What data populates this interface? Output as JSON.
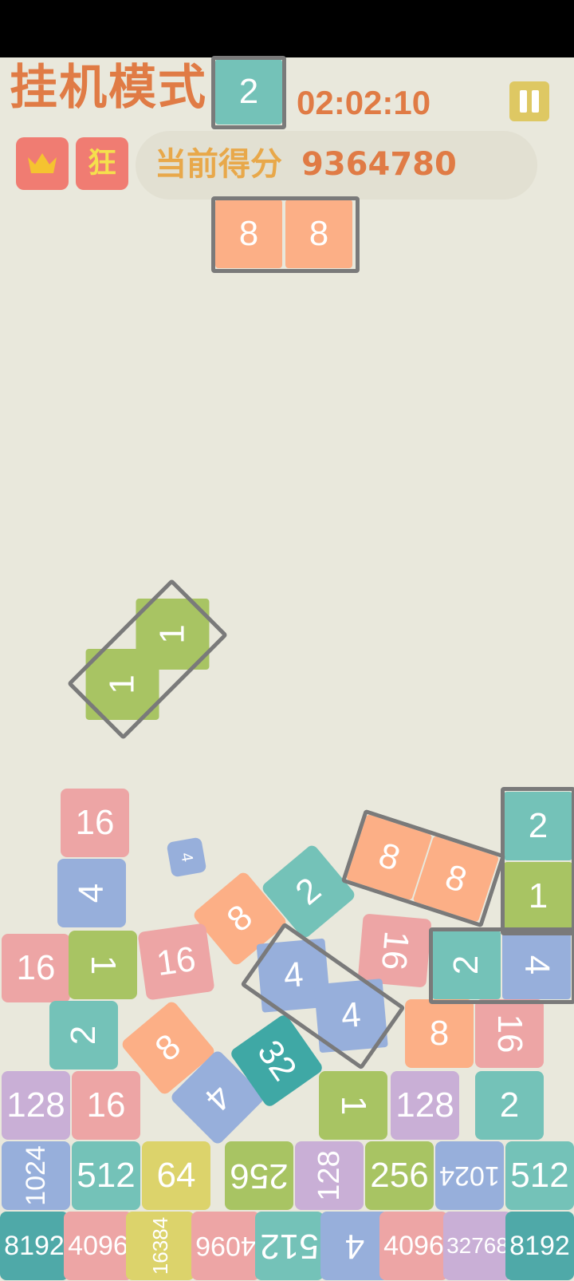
{
  "header": {
    "title": "挂机模式",
    "timer": "02:02:10",
    "score_label": "当前得分",
    "score_value": "9364780",
    "badge_kuang": "狂",
    "icons": [
      "crown-icon",
      "pause-icon"
    ]
  },
  "falling_piece": {
    "top": "2",
    "left": "8",
    "right": "8"
  },
  "tilted_piece": {
    "a": "1",
    "b": "1"
  },
  "tiles": {
    "r_16a": "16",
    "r_4a": "4",
    "r_4small": "4",
    "r_8a": "8",
    "r_2a": "2",
    "r_8pair1": "8",
    "r_8pair2": "8",
    "r_2v": "2",
    "r_1v": "1",
    "r_16b": "16",
    "r_1b": "1",
    "r_16c": "16",
    "r_16d": "16",
    "r_2b": "2",
    "r_4pair": "4",
    "r_44a": "4",
    "r_44b": "4",
    "r_2c": "2",
    "r_8b": "8",
    "r_8c": "8",
    "r_16e": "16",
    "r_4b": "4",
    "r_32": "32",
    "r_128a": "128",
    "r_16f": "16",
    "r_1c": "1",
    "r_128b": "128",
    "r_2d": "2",
    "b_1024a": "1024",
    "b_512a": "512",
    "b_64": "64",
    "b_256a": "256",
    "b_128": "128",
    "b_256b": "256",
    "b_1024b": "1024",
    "b_512b": "512",
    "c_8192a": "8192",
    "c_4096a": "4096",
    "c_16384": "16384",
    "c_4096b": "4096",
    "c_512": "512",
    "c_4": "4",
    "c_4096c": "4096",
    "c_32768": "32768",
    "c_8192b": "8192"
  }
}
